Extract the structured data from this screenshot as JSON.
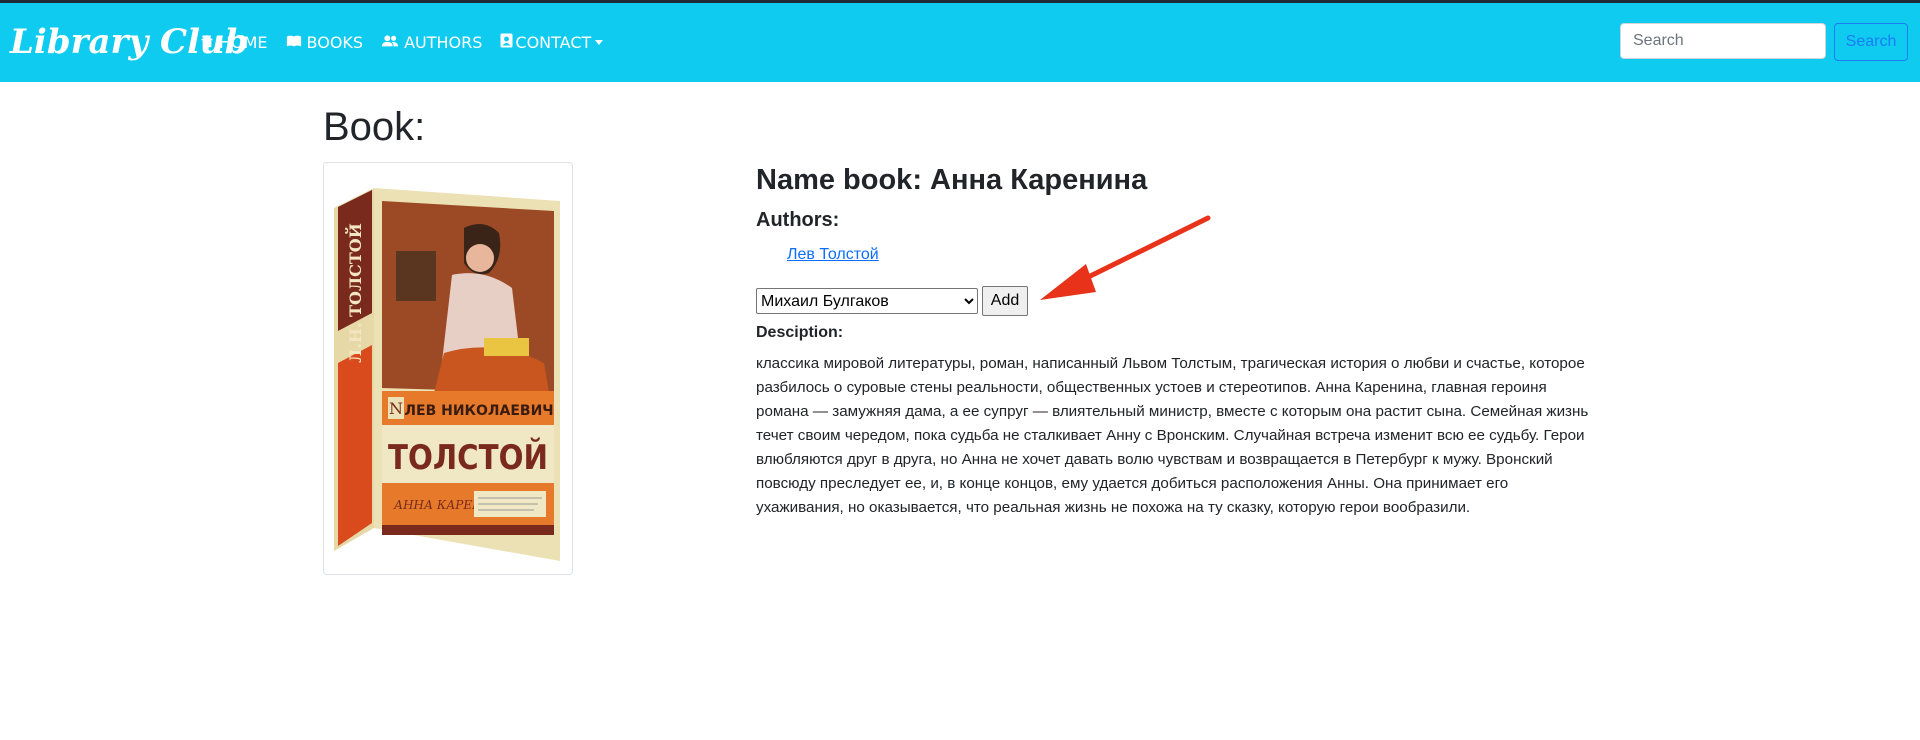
{
  "navbar": {
    "brand": "Library Club",
    "items": [
      {
        "label": "HOME",
        "icon": "home-icon"
      },
      {
        "label": "BOOKS",
        "icon": "book-icon"
      },
      {
        "label": "AUTHORS",
        "icon": "users-icon"
      },
      {
        "label": "CONTACT",
        "icon": "contact-card-icon",
        "dropdown": true
      }
    ],
    "search": {
      "placeholder": "Search",
      "button_label": "Search"
    },
    "colors": {
      "background": "#10cbf0",
      "search_button_text": "#1c7cf5"
    }
  },
  "page": {
    "title": "Book:"
  },
  "book": {
    "cover": {
      "author_spine": "Л.Н. ТОЛСТОЙ",
      "author_first": "ЛЕВ НИКОЛАЕВИЧ",
      "author_last": "ТОЛСТОЙ",
      "book_title": "АННА КАРЕНИНА"
    },
    "name_line": "Name book: Анна Каренина",
    "authors_label": "Authors:",
    "authors": [
      "Лев Толстой"
    ],
    "author_select": {
      "selected": "Михаил Булгаков"
    },
    "add_button": "Add",
    "description_label": "Desciption:",
    "description": "классика мировой литературы, роман, написанный Львом Толстым, трагическая история о любви и счастье, которое разбилось о суровые стены реальности, общественных устоев и стереотипов. Анна Каренина, главная героиня романа — замужняя дама, а ее супруг — влиятельный министр, вместе с которым она растит сына. Семейная жизнь течет своим чередом, пока судьба не сталкивает Анну с Вронским. Случайная встреча изменит всю ее судьбу. Герои влюбляются друг в друга, но Анна не хочет давать волю чувствам и возвращается в Петербург к мужу. Вронский повсюду преследует ее, и, в конце концов, ему удается добиться расположения Анны. Она принимает его ухаживания, но оказывается, что реальная жизнь не похожа на ту сказку, которую герои вообразили."
  },
  "annotation": {
    "arrow_color": "#e8321a"
  }
}
